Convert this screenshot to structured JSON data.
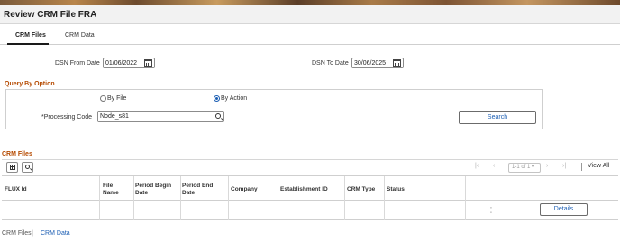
{
  "page": {
    "title": "Review CRM File FRA"
  },
  "tabs": [
    {
      "label": "CRM Files"
    },
    {
      "label": "CRM Data"
    }
  ],
  "criteria": {
    "dsn_from_label": "DSN From Date",
    "dsn_from_value": "01/06/2022",
    "dsn_to_label": "DSN To Date",
    "dsn_to_value": "30/06/2025"
  },
  "query_option": {
    "title": "Query By Option",
    "by_file_label": "By File",
    "by_action_label": "By Action",
    "selected": "By Action",
    "processing_code_label": "*Processing Code",
    "processing_code_value": "Node_s81",
    "search_button": "Search"
  },
  "grid": {
    "title": "CRM Files",
    "pager_text": "1-1 of 1",
    "view_all": "View All",
    "headers": [
      "FLUX Id",
      "File Name",
      "Period Begin Date",
      "Period End Date",
      "Company",
      "Establishment ID",
      "CRM Type",
      "Status"
    ],
    "rows": [
      {
        "flux_id": "",
        "file_name": "",
        "period_begin": "",
        "period_end": "",
        "company": "",
        "establishment_id": "",
        "crm_type": "",
        "status": "",
        "action_button": "Details"
      }
    ]
  },
  "footer": {
    "link1": "CRM Files",
    "divider": "|",
    "link2": "CRM Data"
  },
  "icons": {
    "calendar": "calendar-icon",
    "search": "search-icon",
    "grid_personalize": "grid-personalize-icon",
    "grid_find": "grid-find-icon"
  },
  "colors": {
    "section_title": "#b54a00",
    "link": "#1d5fb4"
  }
}
